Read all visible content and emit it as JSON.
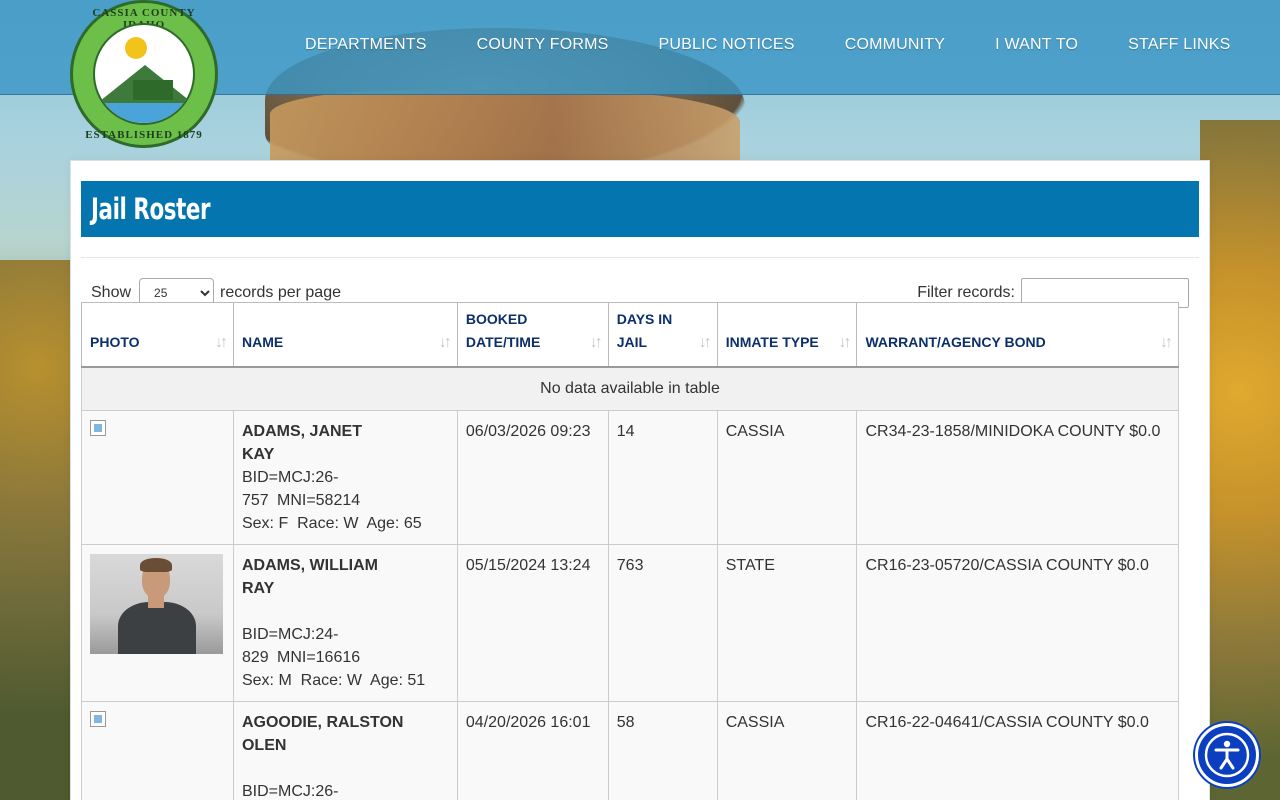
{
  "logo": {
    "ring_top": "CASSIA COUNTY IDAHO",
    "ring_bottom": "ESTABLISHED 1879",
    "colors": {
      "green": "#6cc04a",
      "dark_green": "#2e6b2a"
    }
  },
  "nav": {
    "items": [
      "DEPARTMENTS",
      "COUNTY FORMS",
      "PUBLIC NOTICES",
      "COMMUNITY",
      "I WANT TO",
      "STAFF LINKS"
    ]
  },
  "page": {
    "title": "Jail Roster",
    "title_bar_color": "#0575b0"
  },
  "controls": {
    "show_label": "Show",
    "per_page_value": "25",
    "per_page_options": [
      "25"
    ],
    "per_page_suffix": "records per page",
    "filter_label": "Filter records:",
    "filter_value": ""
  },
  "table": {
    "headers": {
      "photo": "PHOTO",
      "name": "NAME",
      "booked": "BOOKED DATE/TIME",
      "days": "DAYS IN JAIL",
      "type": "INMATE TYPE",
      "warrant": "WARRANT/AGENCY BOND"
    },
    "empty_message": "No data available in table",
    "rows": [
      {
        "photo": "broken-image-icon",
        "name": "ADAMS, JANET KAY",
        "bid": "BID=MCJ:26-757",
        "mni": "MNI=58214",
        "demo": "Sex: F  Race: W  Age: 65",
        "booked": "06/03/2026 09:23",
        "days": "14",
        "type": "CASSIA",
        "warrant": "CR34-23-1858/MINIDOKA COUNTY $0.0"
      },
      {
        "photo": "mugshot",
        "name": "ADAMS, WILLIAM RAY",
        "bid": "BID=MCJ:24-829",
        "mni": "MNI=16616",
        "demo": "Sex: M  Race: W  Age: 51",
        "booked": "05/15/2024 13:24",
        "days": "763",
        "type": "STATE",
        "warrant": "CR16-23-05720/CASSIA COUNTY $0.0"
      },
      {
        "photo": "broken-image-icon",
        "name": "AGOODIE, RALSTON OLEN",
        "bid": "BID=MCJ:26-",
        "mni": "",
        "demo": "",
        "booked": "04/20/2026 16:01",
        "days": "58",
        "type": "CASSIA",
        "warrant": "CR16-22-04641/CASSIA COUNTY $0.0"
      }
    ]
  },
  "accessibility_button": {
    "icon": "accessibility-icon",
    "color": "#0b3fbf"
  }
}
